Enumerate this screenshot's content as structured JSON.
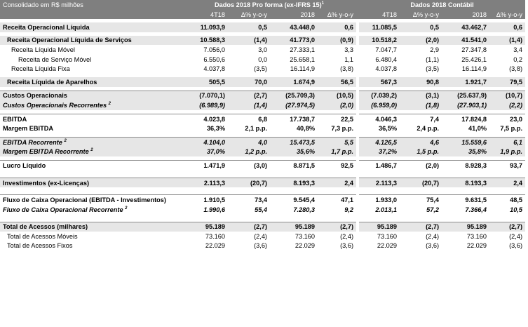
{
  "header": {
    "title": "Consolidado em R$ milhões",
    "group1": "Dados 2018 Pro forma (ex-IFRS 15)",
    "group1_sup": "1",
    "group2": "Dados 2018 Contábil",
    "cols": [
      "4T18",
      "Δ% y-o-y",
      "2018",
      "Δ% y-o-y",
      "4T18",
      "Δ% y-o-y",
      "2018",
      "Δ% y-o-y"
    ]
  },
  "rows": {
    "r1": {
      "label": "Receita Operacional Líquida",
      "v": [
        "11.093,9",
        "0,5",
        "43.448,0",
        "0,6",
        "11.085,5",
        "0,5",
        "43.462,7",
        "0,6"
      ]
    },
    "r2": {
      "label": "Receita Operacional Líquida de Serviços",
      "v": [
        "10.588,3",
        "(1,4)",
        "41.773,0",
        "(0,9)",
        "10.518,2",
        "(2,0)",
        "41.541,0",
        "(1,4)"
      ]
    },
    "r3": {
      "label": "Receita Líquida Móvel",
      "v": [
        "7.056,0",
        "3,0",
        "27.333,1",
        "3,3",
        "7.047,7",
        "2,9",
        "27.347,8",
        "3,4"
      ]
    },
    "r4": {
      "label": "Receita de Serviço Móvel",
      "v": [
        "6.550,6",
        "0,0",
        "25.658,1",
        "1,1",
        "6.480,4",
        "(1,1)",
        "25.426,1",
        "0,2"
      ]
    },
    "r5": {
      "label": "Receita Líquida Fixa",
      "v": [
        "4.037,8",
        "(3,5)",
        "16.114,9",
        "(3,8)",
        "4.037,8",
        "(3,5)",
        "16.114,9",
        "(3,8)"
      ]
    },
    "r6": {
      "label": "Receita Líquida de Aparelhos",
      "v": [
        "505,5",
        "70,0",
        "1.674,9",
        "56,5",
        "567,3",
        "90,8",
        "1.921,7",
        "79,5"
      ]
    },
    "r7": {
      "label": "Custos Operacionais",
      "v": [
        "(7.070,1)",
        "(2,7)",
        "(25.709,3)",
        "(10,5)",
        "(7.039,2)",
        "(3,1)",
        "(25.637,9)",
        "(10,7)"
      ]
    },
    "r8": {
      "label": "Custos Operacionais Recorrentes",
      "sup": "2",
      "v": [
        "(6.989,9)",
        "(1,4)",
        "(27.974,5)",
        "(2,0)",
        "(6.959,0)",
        "(1,8)",
        "(27.903,1)",
        "(2,2)"
      ]
    },
    "r9": {
      "label": "EBITDA",
      "v": [
        "4.023,8",
        "6,8",
        "17.738,7",
        "22,5",
        "4.046,3",
        "7,4",
        "17.824,8",
        "23,0"
      ]
    },
    "r10": {
      "label": "Margem EBITDA",
      "v": [
        "36,3%",
        "2,1 p.p.",
        "40,8%",
        "7,3 p.p.",
        "36,5%",
        "2,4 p.p.",
        "41,0%",
        "7,5 p.p."
      ]
    },
    "r11": {
      "label": "EBITDA Recorrente",
      "sup": "2",
      "v": [
        "4.104,0",
        "4,0",
        "15.473,5",
        "5,5",
        "4.126,5",
        "4,6",
        "15.559,6",
        "6,1"
      ]
    },
    "r12": {
      "label": "Margem EBITDA Recorrente",
      "sup": "2",
      "v": [
        "37,0%",
        "1,2 p.p.",
        "35,6%",
        "1,7 p.p.",
        "37,2%",
        "1,5 p.p.",
        "35,8%",
        "1,9 p.p."
      ]
    },
    "r13": {
      "label": "Lucro Líquido",
      "v": [
        "1.471,9",
        "(3,0)",
        "8.871,5",
        "92,5",
        "1.486,7",
        "(2,0)",
        "8.928,3",
        "93,7"
      ]
    },
    "r14": {
      "label": "Investimentos (ex-Licenças)",
      "v": [
        "2.113,3",
        "(20,7)",
        "8.193,3",
        "2,4",
        "2.113,3",
        "(20,7)",
        "8.193,3",
        "2,4"
      ]
    },
    "r15": {
      "label": "Fluxo de Caixa Operacional (EBITDA - Investimentos)",
      "v": [
        "1.910,5",
        "73,4",
        "9.545,4",
        "47,1",
        "1.933,0",
        "75,4",
        "9.631,5",
        "48,5"
      ]
    },
    "r16": {
      "label": "Fluxo de Caixa Operacional Recorrente",
      "sup": "2",
      "v": [
        "1.990,6",
        "55,4",
        "7.280,3",
        "9,2",
        "2.013,1",
        "57,2",
        "7.366,4",
        "10,5"
      ]
    },
    "r17": {
      "label": "Total de Acessos (milhares)",
      "v": [
        "95.189",
        "(2,7)",
        "95.189",
        "(2,7)",
        "95.189",
        "(2,7)",
        "95.189",
        "(2,7)"
      ]
    },
    "r18": {
      "label": "Total de Acessos Móveis",
      "v": [
        "73.160",
        "(2,4)",
        "73.160",
        "(2,4)",
        "73.160",
        "(2,4)",
        "73.160",
        "(2,4)"
      ]
    },
    "r19": {
      "label": "Total de Acessos Fixos",
      "v": [
        "22.029",
        "(3,6)",
        "22.029",
        "(3,6)",
        "22.029",
        "(3,6)",
        "22.029",
        "(3,6)"
      ]
    }
  }
}
